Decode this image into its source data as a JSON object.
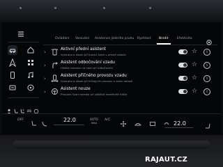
{
  "tabs": [
    {
      "label": "Ovládání",
      "active": false
    },
    {
      "label": "Varování",
      "active": false
    },
    {
      "label": "Asistence jízdního pruhu",
      "active": false
    },
    {
      "label": "Rychlost",
      "active": false
    },
    {
      "label": "Brzdit",
      "active": true
    },
    {
      "label": "Efektivita",
      "active": false
    }
  ],
  "assistants": [
    {
      "title": "Aktivní přední asistent",
      "description": "Výstraha a zásah při hrozící kolizi v přední oblasti",
      "icon": "front-assist-icon",
      "enabled": true
    },
    {
      "title": "Asistent odbočování vzadu",
      "description": "Hlídání provozu za vámi při odbočování",
      "icon": "turn-assist-icon",
      "enabled": true
    },
    {
      "title": "Asistent příčného provozu vzadu",
      "description": "Výstraha a zásah při křížujícím provozu v zadní oblasti",
      "icon": "rear-cross-traffic-icon",
      "enabled": true
    },
    {
      "title": "Asistent nouze",
      "description": "Převzetí řízení vozidla při zjištěné neaktivitě řidiče",
      "icon": "emergency-assist-icon",
      "enabled": true
    }
  ],
  "climate": {
    "left_off": "OFF",
    "left_temp": "22.0",
    "auto_label": "AUTO",
    "auto_sub": "MAX",
    "ac_label": "A/C",
    "right_temp": "22.0"
  },
  "watermark": "RAJAUT.CZ",
  "colors": {
    "accent": "#ffffff",
    "screen_bg": "#050608",
    "text_dim": "#8e949c"
  }
}
